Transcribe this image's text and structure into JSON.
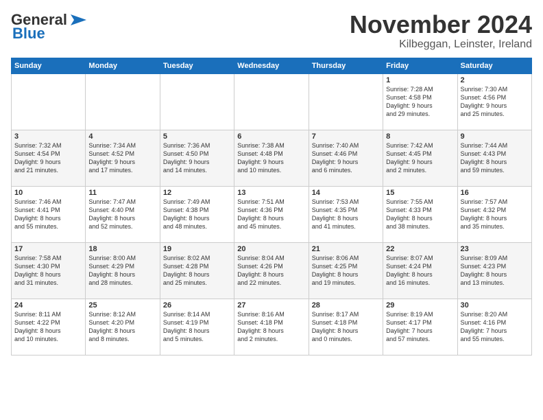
{
  "logo": {
    "line1": "General",
    "line2": "Blue"
  },
  "title": "November 2024",
  "subtitle": "Kilbeggan, Leinster, Ireland",
  "headers": [
    "Sunday",
    "Monday",
    "Tuesday",
    "Wednesday",
    "Thursday",
    "Friday",
    "Saturday"
  ],
  "weeks": [
    [
      {
        "day": "",
        "info": ""
      },
      {
        "day": "",
        "info": ""
      },
      {
        "day": "",
        "info": ""
      },
      {
        "day": "",
        "info": ""
      },
      {
        "day": "",
        "info": ""
      },
      {
        "day": "1",
        "info": "Sunrise: 7:28 AM\nSunset: 4:58 PM\nDaylight: 9 hours\nand 29 minutes."
      },
      {
        "day": "2",
        "info": "Sunrise: 7:30 AM\nSunset: 4:56 PM\nDaylight: 9 hours\nand 25 minutes."
      }
    ],
    [
      {
        "day": "3",
        "info": "Sunrise: 7:32 AM\nSunset: 4:54 PM\nDaylight: 9 hours\nand 21 minutes."
      },
      {
        "day": "4",
        "info": "Sunrise: 7:34 AM\nSunset: 4:52 PM\nDaylight: 9 hours\nand 17 minutes."
      },
      {
        "day": "5",
        "info": "Sunrise: 7:36 AM\nSunset: 4:50 PM\nDaylight: 9 hours\nand 14 minutes."
      },
      {
        "day": "6",
        "info": "Sunrise: 7:38 AM\nSunset: 4:48 PM\nDaylight: 9 hours\nand 10 minutes."
      },
      {
        "day": "7",
        "info": "Sunrise: 7:40 AM\nSunset: 4:46 PM\nDaylight: 9 hours\nand 6 minutes."
      },
      {
        "day": "8",
        "info": "Sunrise: 7:42 AM\nSunset: 4:45 PM\nDaylight: 9 hours\nand 2 minutes."
      },
      {
        "day": "9",
        "info": "Sunrise: 7:44 AM\nSunset: 4:43 PM\nDaylight: 8 hours\nand 59 minutes."
      }
    ],
    [
      {
        "day": "10",
        "info": "Sunrise: 7:46 AM\nSunset: 4:41 PM\nDaylight: 8 hours\nand 55 minutes."
      },
      {
        "day": "11",
        "info": "Sunrise: 7:47 AM\nSunset: 4:40 PM\nDaylight: 8 hours\nand 52 minutes."
      },
      {
        "day": "12",
        "info": "Sunrise: 7:49 AM\nSunset: 4:38 PM\nDaylight: 8 hours\nand 48 minutes."
      },
      {
        "day": "13",
        "info": "Sunrise: 7:51 AM\nSunset: 4:36 PM\nDaylight: 8 hours\nand 45 minutes."
      },
      {
        "day": "14",
        "info": "Sunrise: 7:53 AM\nSunset: 4:35 PM\nDaylight: 8 hours\nand 41 minutes."
      },
      {
        "day": "15",
        "info": "Sunrise: 7:55 AM\nSunset: 4:33 PM\nDaylight: 8 hours\nand 38 minutes."
      },
      {
        "day": "16",
        "info": "Sunrise: 7:57 AM\nSunset: 4:32 PM\nDaylight: 8 hours\nand 35 minutes."
      }
    ],
    [
      {
        "day": "17",
        "info": "Sunrise: 7:58 AM\nSunset: 4:30 PM\nDaylight: 8 hours\nand 31 minutes."
      },
      {
        "day": "18",
        "info": "Sunrise: 8:00 AM\nSunset: 4:29 PM\nDaylight: 8 hours\nand 28 minutes."
      },
      {
        "day": "19",
        "info": "Sunrise: 8:02 AM\nSunset: 4:28 PM\nDaylight: 8 hours\nand 25 minutes."
      },
      {
        "day": "20",
        "info": "Sunrise: 8:04 AM\nSunset: 4:26 PM\nDaylight: 8 hours\nand 22 minutes."
      },
      {
        "day": "21",
        "info": "Sunrise: 8:06 AM\nSunset: 4:25 PM\nDaylight: 8 hours\nand 19 minutes."
      },
      {
        "day": "22",
        "info": "Sunrise: 8:07 AM\nSunset: 4:24 PM\nDaylight: 8 hours\nand 16 minutes."
      },
      {
        "day": "23",
        "info": "Sunrise: 8:09 AM\nSunset: 4:23 PM\nDaylight: 8 hours\nand 13 minutes."
      }
    ],
    [
      {
        "day": "24",
        "info": "Sunrise: 8:11 AM\nSunset: 4:22 PM\nDaylight: 8 hours\nand 10 minutes."
      },
      {
        "day": "25",
        "info": "Sunrise: 8:12 AM\nSunset: 4:20 PM\nDaylight: 8 hours\nand 8 minutes."
      },
      {
        "day": "26",
        "info": "Sunrise: 8:14 AM\nSunset: 4:19 PM\nDaylight: 8 hours\nand 5 minutes."
      },
      {
        "day": "27",
        "info": "Sunrise: 8:16 AM\nSunset: 4:18 PM\nDaylight: 8 hours\nand 2 minutes."
      },
      {
        "day": "28",
        "info": "Sunrise: 8:17 AM\nSunset: 4:18 PM\nDaylight: 8 hours\nand 0 minutes."
      },
      {
        "day": "29",
        "info": "Sunrise: 8:19 AM\nSunset: 4:17 PM\nDaylight: 7 hours\nand 57 minutes."
      },
      {
        "day": "30",
        "info": "Sunrise: 8:20 AM\nSunset: 4:16 PM\nDaylight: 7 hours\nand 55 minutes."
      }
    ]
  ]
}
